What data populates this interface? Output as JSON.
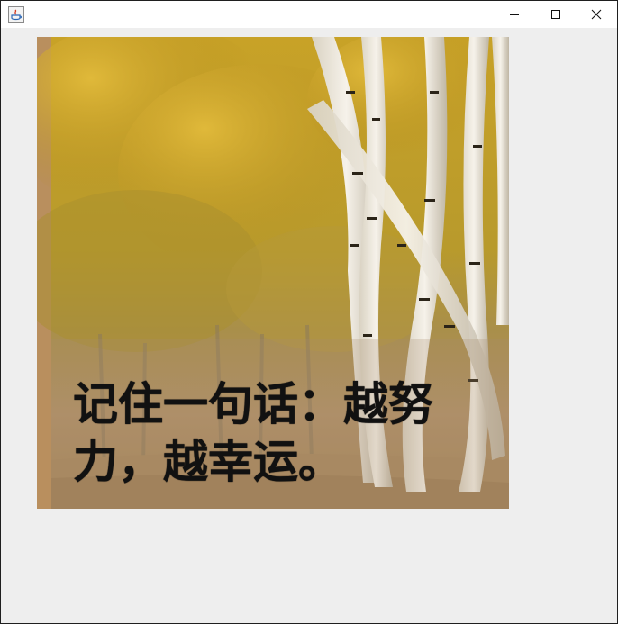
{
  "window": {
    "controls": {
      "minimize_icon": "minimize-icon",
      "maximize_icon": "maximize-icon",
      "close_icon": "close-icon"
    }
  },
  "image": {
    "caption": "记住一句话：越努力，越幸运。"
  },
  "colors": {
    "background": "#eeeeee",
    "foliage": "#c9a326",
    "ground": "#a98a62",
    "border_strip": "#b98f5e"
  }
}
